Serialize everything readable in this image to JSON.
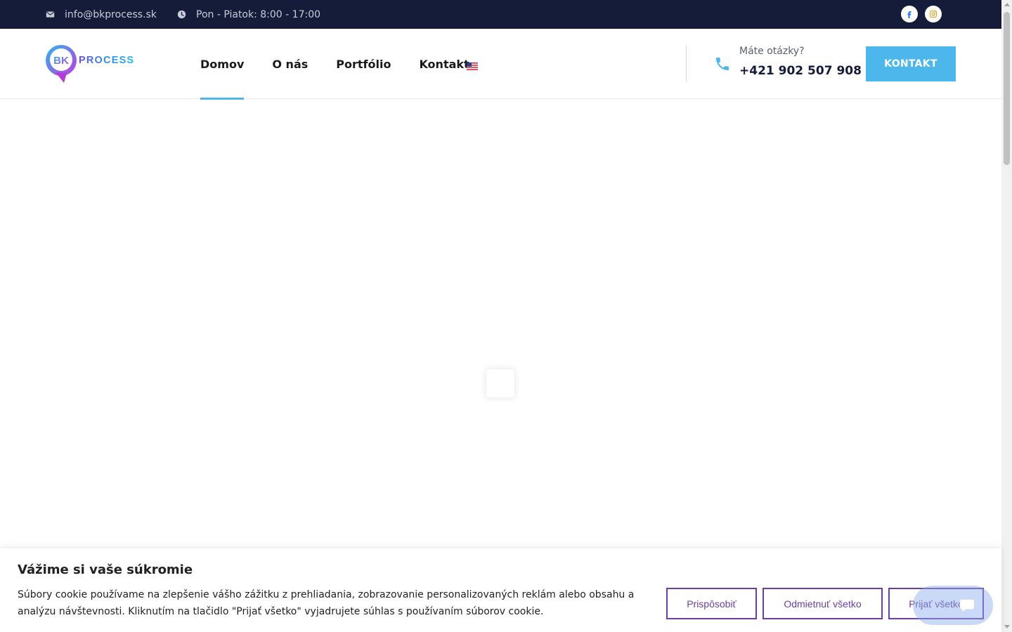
{
  "topbar": {
    "email": "info@bkprocess.sk",
    "hours": "Pon - Piatok: 8:00 - 17:00",
    "email_icon": "envelope-icon",
    "hours_icon": "clock-icon",
    "social": [
      "facebook-icon",
      "instagram-icon"
    ]
  },
  "header": {
    "logo": {
      "letters": "BK",
      "word": "PROCESS"
    },
    "nav": [
      {
        "label": "Domov",
        "active": true
      },
      {
        "label": "O nás",
        "active": false
      },
      {
        "label": "Portfólio",
        "active": false
      },
      {
        "label": "Kontakt",
        "active": false
      }
    ],
    "language_icon": "us-flag-icon",
    "phone_label": "Máte otázky?",
    "phone_number": "+421 902 507 908",
    "cta_label": "KONTAKT"
  },
  "cookie": {
    "title": "Vážime si vaše súkromie",
    "text": "Súbory cookie používame na zlepšenie vášho zážitku z prehliadania, zobrazovanie personalizovaných reklám alebo obsahu a analýzu návštevnosti. Kliknutím na tlačidlo \"Prijať všetko\" vyjadrujete súhlas s používaním súborov cookie.",
    "customize_label": "Prispôsobiť",
    "reject_label": "Odmietnuť všetko",
    "accept_label": "Prijať všetko"
  },
  "colors": {
    "topbar_bg": "#141c3a",
    "accent": "#4db7ec",
    "cookie_accent": "#6b3fa0",
    "facebook": "#1877f2",
    "instagram": "#e3a325"
  }
}
